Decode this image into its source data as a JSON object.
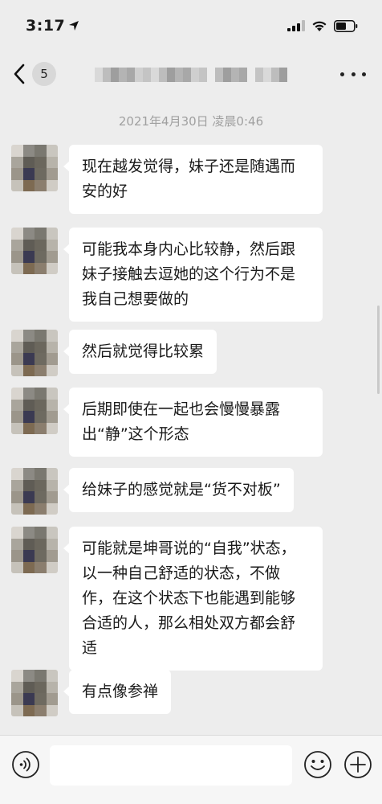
{
  "status_bar": {
    "time": "3:17"
  },
  "nav": {
    "unread_count": "5"
  },
  "chat": {
    "timestamp": "2021年4月30日 凌晨0:46",
    "messages": [
      {
        "text": "现在越发觉得，妹子还是随遇而安的好"
      },
      {
        "text": "可能我本身内心比较静，然后跟妹子接触去逗她的这个行为不是我自己想要做的"
      },
      {
        "text": "然后就觉得比较累"
      },
      {
        "text": "后期即使在一起也会慢慢暴露出“静”这个形态"
      },
      {
        "text": "给妹子的感觉就是“货不对板”"
      },
      {
        "text": "可能就是坤哥说的“自我”状态，以一种自己舒适的状态，不做作，在这个状态下也能遇到能够合适的人，那么相处双方都会舒适"
      },
      {
        "text": "有点像参禅"
      }
    ]
  },
  "input": {
    "value": ""
  },
  "icons": {
    "back": "chevron-left-icon",
    "more": "more-dots-icon",
    "voice": "voice-icon",
    "emoji": "emoji-icon",
    "plus": "plus-icon",
    "location": "location-arrow-icon",
    "signal": "signal-icon",
    "wifi": "wifi-icon",
    "battery": "battery-icon"
  },
  "colors": {
    "background": "#ededed",
    "bubble": "#ffffff",
    "timestamp": "#a0a0a0"
  }
}
